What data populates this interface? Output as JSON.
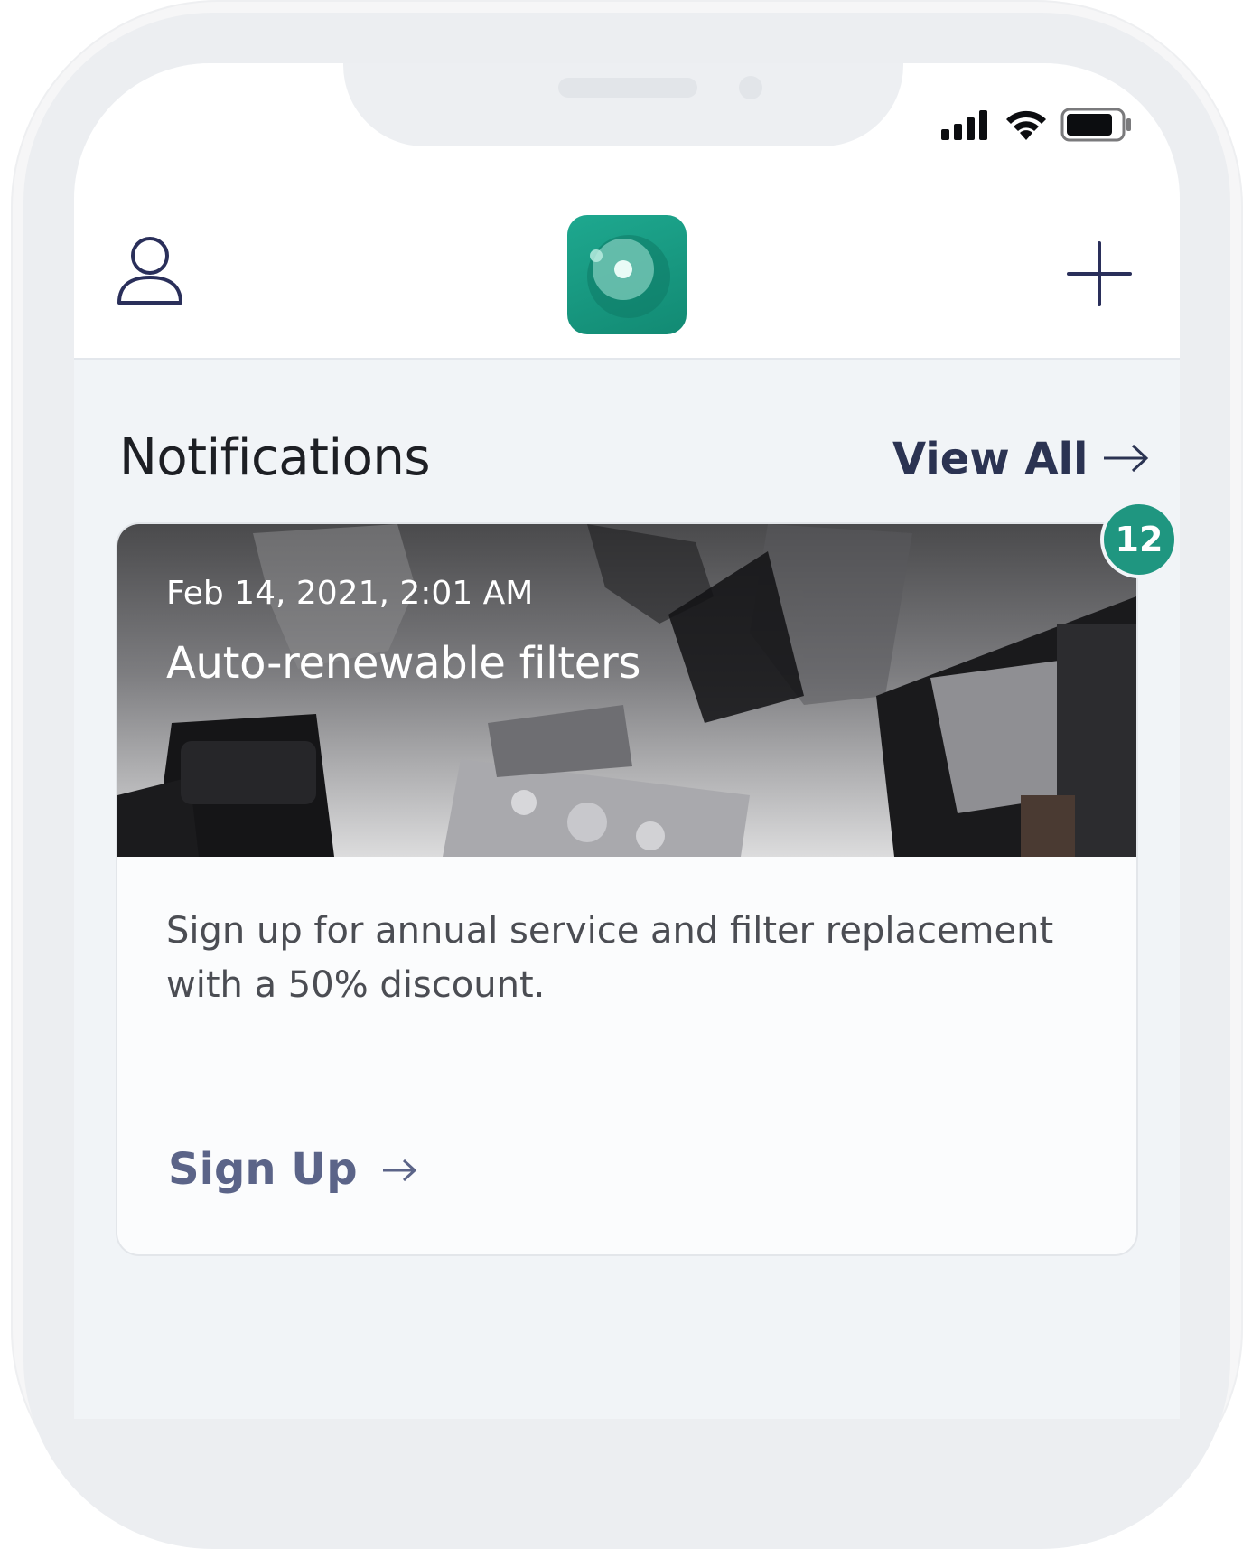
{
  "notifications": {
    "title": "Notifications",
    "view_all_label": "View All",
    "unread_count": "12"
  },
  "card": {
    "date": "Feb 14, 2021, 2:01 AM",
    "title": "Auto-renewable filters",
    "body": "Sign up for annual service and filter replacement with a 50% discount.",
    "cta_label": "Sign Up"
  },
  "icons": {
    "profile": "user-outline-icon",
    "add": "plus-icon",
    "logo": "app-logo",
    "status": [
      "cellular-signal-icon",
      "wifi-icon",
      "battery-icon"
    ]
  },
  "colors": {
    "accent_teal": "#1f9680",
    "nav_ink": "#2b3352",
    "cta_ink": "#5b6488",
    "background": "#f1f4f7"
  }
}
